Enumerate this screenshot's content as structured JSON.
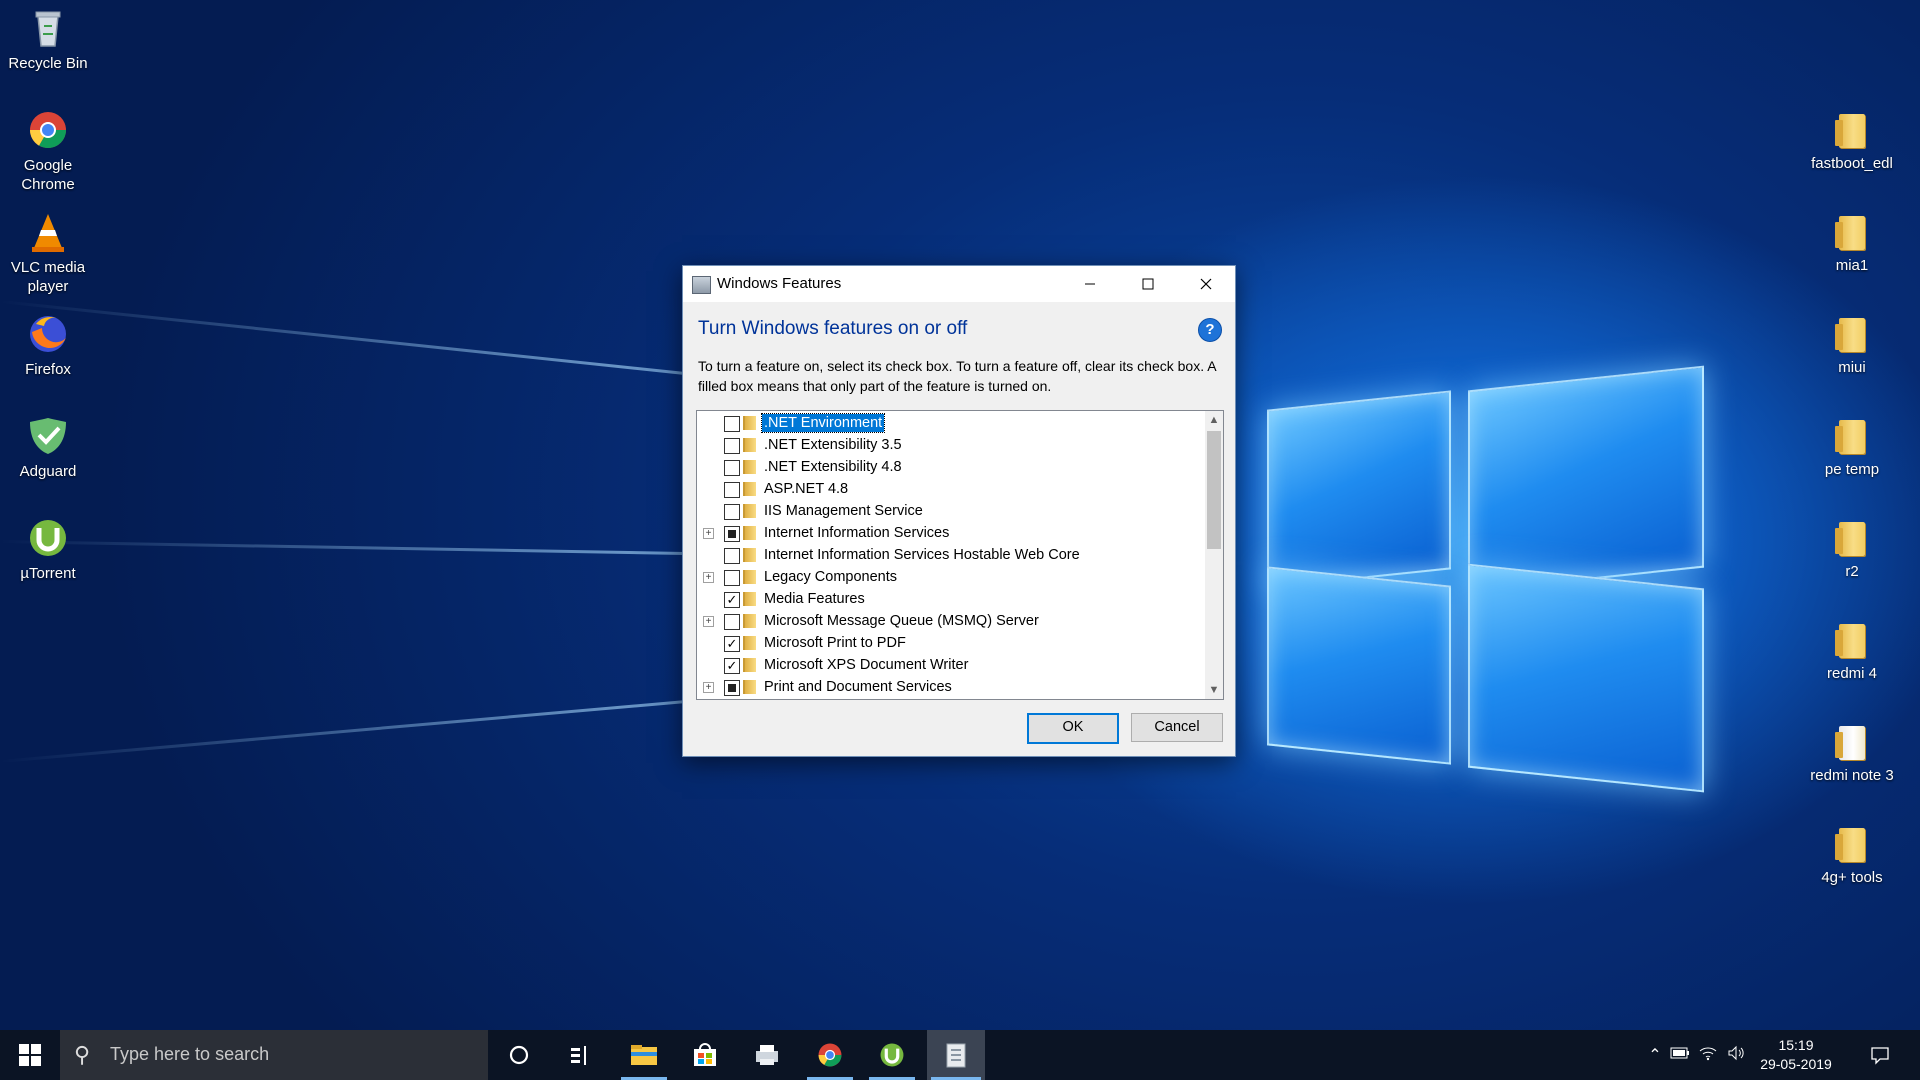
{
  "desktop": {
    "left_icons": [
      {
        "label": "Recycle Bin",
        "icon": "recycle-bin-icon"
      },
      {
        "label": "Google Chrome",
        "icon": "chrome-icon"
      },
      {
        "label": "VLC media player",
        "icon": "vlc-icon"
      },
      {
        "label": "Firefox",
        "icon": "firefox-icon"
      },
      {
        "label": "Adguard",
        "icon": "adguard-icon"
      },
      {
        "label": "µTorrent",
        "icon": "utorrent-icon"
      }
    ],
    "right_icons": [
      {
        "label": "fastboot_edl",
        "icon": "folder-icon"
      },
      {
        "label": "mia1",
        "icon": "folder-icon"
      },
      {
        "label": "miui",
        "icon": "folder-icon"
      },
      {
        "label": "pe temp",
        "icon": "folder-icon"
      },
      {
        "label": "r2",
        "icon": "folder-icon"
      },
      {
        "label": "redmi 4",
        "icon": "folder-icon"
      },
      {
        "label": "redmi note 3",
        "icon": "folder-icon"
      },
      {
        "label": "4g+ tools",
        "icon": "folder-icon"
      }
    ]
  },
  "dialog": {
    "title": "Windows Features",
    "heading": "Turn Windows features on or off",
    "description": "To turn a feature on, select its check box. To turn a feature off, clear its check box. A filled box means that only part of the feature is turned on.",
    "help_glyph": "?",
    "features": [
      {
        "label": ".NET Environment",
        "state": "off",
        "expandable": false,
        "selected": true
      },
      {
        "label": ".NET Extensibility 3.5",
        "state": "off",
        "expandable": false,
        "selected": false
      },
      {
        "label": ".NET Extensibility 4.8",
        "state": "off",
        "expandable": false,
        "selected": false
      },
      {
        "label": "ASP.NET 4.8",
        "state": "off",
        "expandable": false,
        "selected": false
      },
      {
        "label": "IIS Management Service",
        "state": "off",
        "expandable": false,
        "selected": false
      },
      {
        "label": "Internet Information Services",
        "state": "partial",
        "expandable": true,
        "selected": false
      },
      {
        "label": "Internet Information Services Hostable Web Core",
        "state": "off",
        "expandable": false,
        "selected": false
      },
      {
        "label": "Legacy Components",
        "state": "off",
        "expandable": true,
        "selected": false
      },
      {
        "label": "Media Features",
        "state": "on",
        "expandable": false,
        "selected": false
      },
      {
        "label": "Microsoft Message Queue (MSMQ) Server",
        "state": "off",
        "expandable": true,
        "selected": false
      },
      {
        "label": "Microsoft Print to PDF",
        "state": "on",
        "expandable": false,
        "selected": false
      },
      {
        "label": "Microsoft XPS Document Writer",
        "state": "on",
        "expandable": false,
        "selected": false
      },
      {
        "label": "Print and Document Services",
        "state": "partial",
        "expandable": true,
        "selected": false
      }
    ],
    "ok_label": "OK",
    "cancel_label": "Cancel"
  },
  "taskbar": {
    "search_placeholder": "Type here to search",
    "time": "15:19",
    "date": "29-05-2019"
  },
  "colors": {
    "accent": "#0078d7",
    "heading": "#003399",
    "taskbar": "#0b1424"
  }
}
